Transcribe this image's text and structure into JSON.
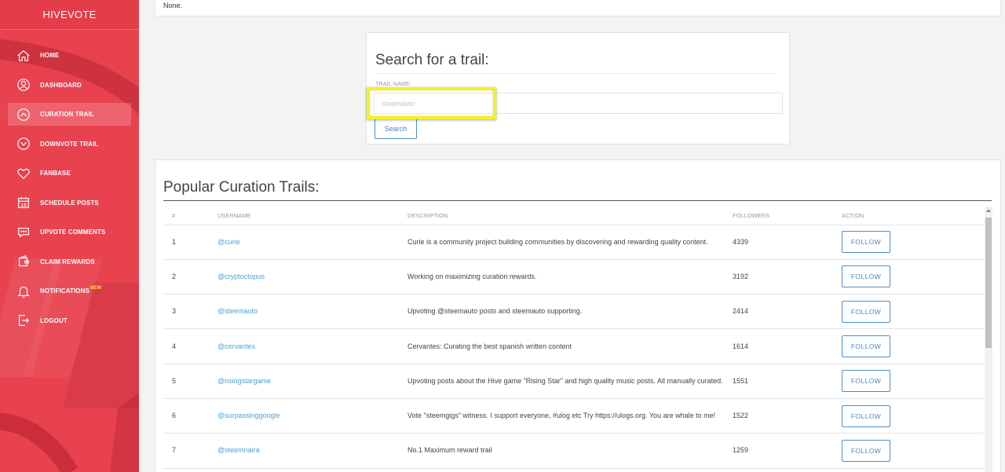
{
  "sidebar": {
    "brand": "HIVEVOTE",
    "items": [
      {
        "label": "HOME",
        "icon": "home-icon"
      },
      {
        "label": "DASHBOARD",
        "icon": "user-circle-icon"
      },
      {
        "label": "CURATION TRAIL",
        "icon": "chevron-up-circle-icon"
      },
      {
        "label": "DOWNVOTE TRAIL",
        "icon": "chevron-down-circle-icon"
      },
      {
        "label": "FANBASE",
        "icon": "heart-icon"
      },
      {
        "label": "SCHEDULE POSTS",
        "icon": "calendar-icon"
      },
      {
        "label": "UPVOTE COMMENTS",
        "icon": "comment-icon"
      },
      {
        "label": "CLAIM REWARDS",
        "icon": "wallet-icon"
      },
      {
        "label": "NOTIFICATIONS",
        "icon": "bell-icon",
        "badge": "NEW"
      },
      {
        "label": "LOGOUT",
        "icon": "logout-icon"
      }
    ],
    "active_index": 2
  },
  "top_card": {
    "text": "None."
  },
  "search": {
    "title": "Search for a trail:",
    "field_label": "TRAIL NAME:",
    "placeholder": "steemauto",
    "button_label": "Search"
  },
  "popular": {
    "title": "Popular Curation Trails:",
    "columns": [
      "#",
      "USERNAME",
      "DESCRIPTION",
      "FOLLOWERS",
      "ACTION"
    ],
    "rows": [
      {
        "num": "1",
        "user": "@curie",
        "desc": "Curie is a community project building communities by discovering and rewarding quality content.",
        "followers": "4339",
        "action": "FOLLOW"
      },
      {
        "num": "2",
        "user": "@cryptoctopus",
        "desc": "Working on maximizing curation rewards.",
        "followers": "3192",
        "action": "FOLLOW"
      },
      {
        "num": "3",
        "user": "@steemauto",
        "desc": "Upvoting @steemauto posts and steemauto supporting.",
        "followers": "2414",
        "action": "FOLLOW"
      },
      {
        "num": "4",
        "user": "@cervantes",
        "desc": "Cervantes: Curating the best spanish written content",
        "followers": "1614",
        "action": "FOLLOW"
      },
      {
        "num": "5",
        "user": "@risingstargame",
        "desc": "Upvoting posts about the Hive game \"Rising Star\" and high quality music posts. All manually curated.",
        "followers": "1551",
        "action": "FOLLOW"
      },
      {
        "num": "6",
        "user": "@surpassinggoogle",
        "desc": "Vote \"steemgigs\" witness. I support everyone, #ulog etc Try https://ulogs.org. You are whale to me!",
        "followers": "1522",
        "action": "FOLLOW"
      },
      {
        "num": "7",
        "user": "@steemnaira",
        "desc": "No.1 Maximum reward trail",
        "followers": "1259",
        "action": "FOLLOW"
      }
    ]
  },
  "colors": {
    "sidebar": "#e8424f",
    "accent": "#4a90c8",
    "highlight": "#f5f21c",
    "link": "#4aa4d6"
  }
}
